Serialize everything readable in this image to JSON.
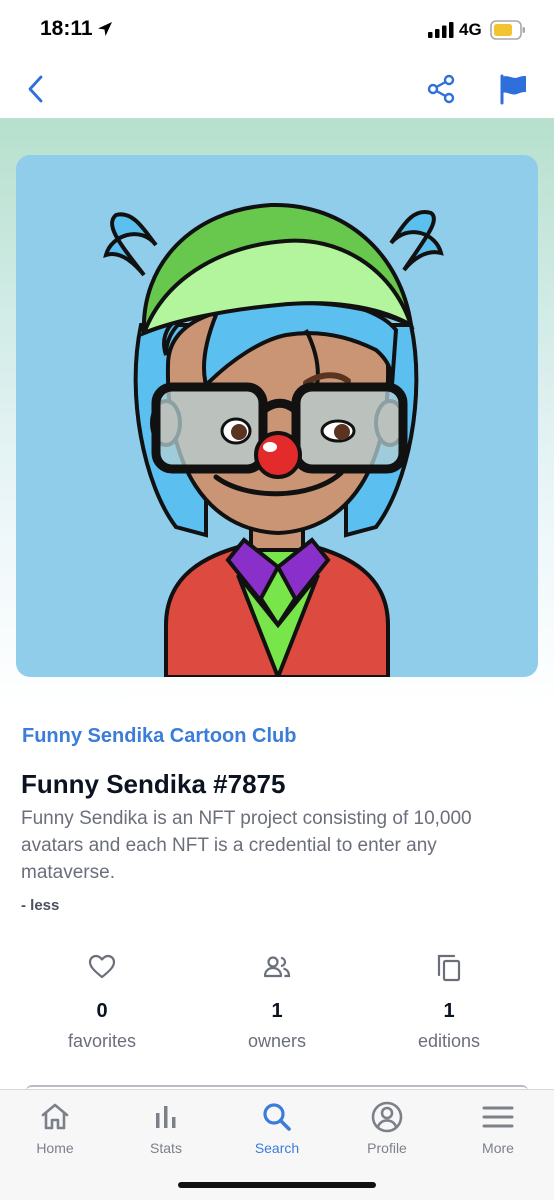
{
  "status_bar": {
    "time": "18:11",
    "network": "4G",
    "icons": [
      "location-arrow-icon",
      "signal-bars-icon",
      "battery-icon"
    ],
    "battery_color": "#f4c430"
  },
  "nav": {
    "icons": [
      "back-chevron-icon",
      "share-icon",
      "flag-icon"
    ],
    "accent": "#2f6fdb"
  },
  "nft": {
    "collection": "Funny Sendika Cartoon Club",
    "title": "Funny Sendika #7875",
    "description": "Funny Sendika is an NFT project consisting of 10,000 avatars and each NFT is a credential to enter any mataverse.",
    "less_label": "- less"
  },
  "stats": [
    {
      "icon": "heart-icon",
      "value": "0",
      "label": "favorites"
    },
    {
      "icon": "people-icon",
      "value": "1",
      "label": "owners"
    },
    {
      "icon": "copy-icon",
      "value": "1",
      "label": "editions"
    }
  ],
  "tabs": [
    {
      "icon": "home-icon",
      "label": "Home",
      "active": false
    },
    {
      "icon": "bar-chart-icon",
      "label": "Stats",
      "active": false
    },
    {
      "icon": "search-icon",
      "label": "Search",
      "active": true
    },
    {
      "icon": "profile-icon",
      "label": "Profile",
      "active": false
    },
    {
      "icon": "menu-icon",
      "label": "More",
      "active": false
    }
  ],
  "colors": {
    "accent": "#3b7dd8",
    "art_background": "#90cdea",
    "tab_inactive": "#7c8089"
  }
}
